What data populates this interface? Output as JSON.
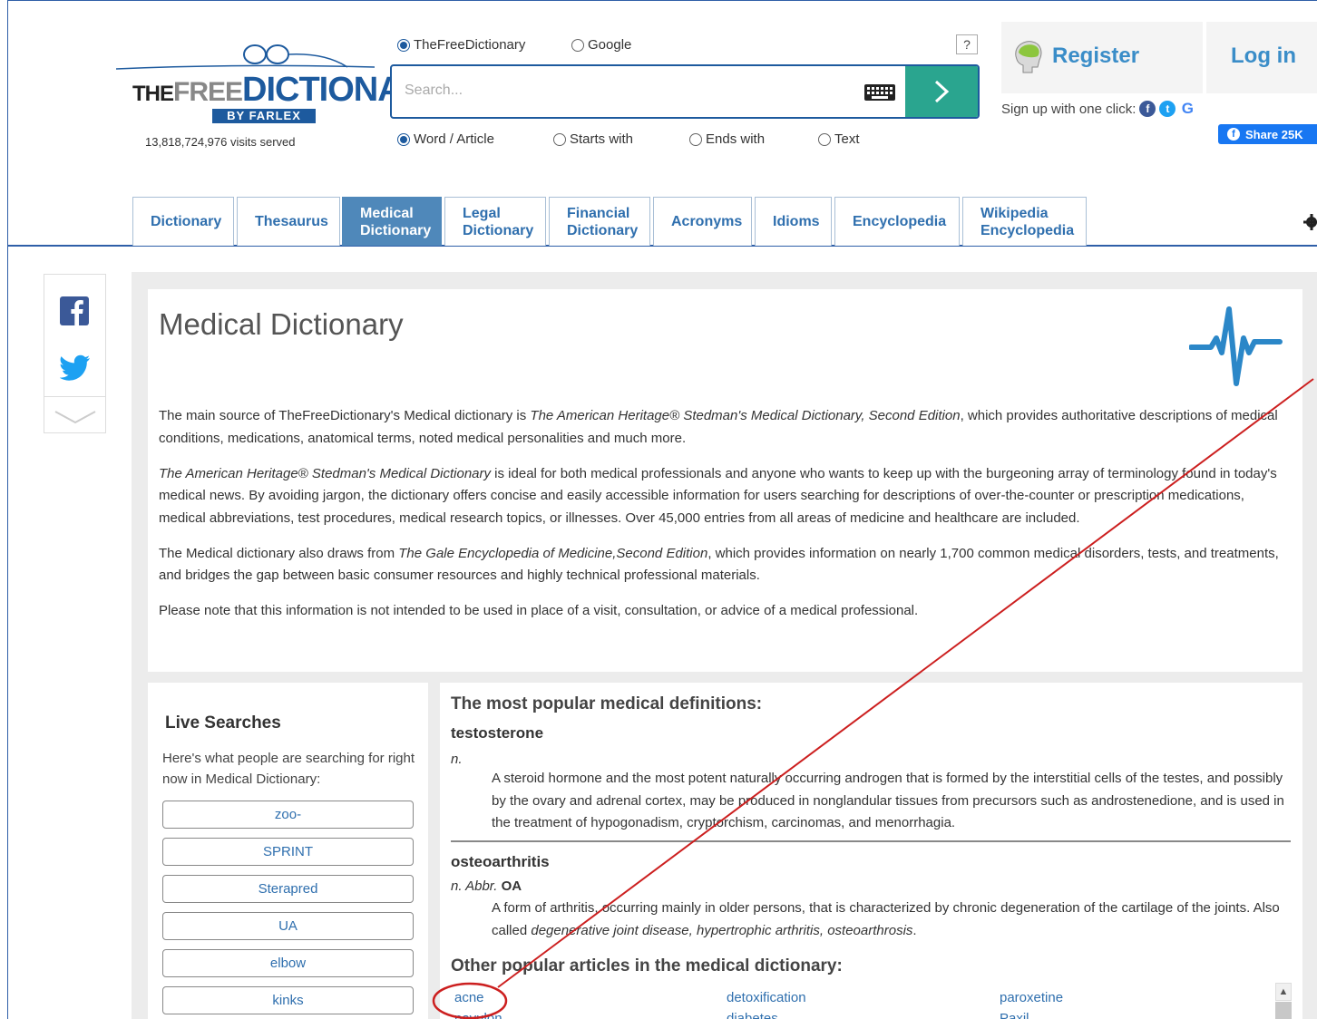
{
  "header": {
    "logo": {
      "the": "THE",
      "free": "FREE",
      "dictionary": "DICTIONARY",
      "byline": "BY FARLEX"
    },
    "visits": "13,818,724,976 visits served",
    "source_options": [
      {
        "label": "TheFreeDictionary",
        "selected": true
      },
      {
        "label": "Google",
        "selected": false
      }
    ],
    "help_label": "?",
    "search": {
      "placeholder": "Search...",
      "value": ""
    },
    "mode_options": [
      {
        "label": "Word / Article",
        "selected": true
      },
      {
        "label": "Starts with",
        "selected": false
      },
      {
        "label": "Ends with",
        "selected": false
      },
      {
        "label": "Text",
        "selected": false
      }
    ],
    "register_label": "Register",
    "login_label": "Log in",
    "signup_text": "Sign up with one click:",
    "share_label": "Share 25K"
  },
  "tabs": [
    {
      "label": "Dictionary",
      "active": false
    },
    {
      "label": "Thesaurus",
      "active": false
    },
    {
      "label": "Medical Dictionary",
      "active": true
    },
    {
      "label": "Legal Dictionary",
      "active": false
    },
    {
      "label": "Financial Dictionary",
      "active": false
    },
    {
      "label": "Acronyms",
      "active": false
    },
    {
      "label": "Idioms",
      "active": false
    },
    {
      "label": "Encyclopedia",
      "active": false
    },
    {
      "label": "Wikipedia Encyclopedia",
      "active": false
    }
  ],
  "intro": {
    "title": "Medical Dictionary",
    "p1_a": "The main source of TheFreeDictionary's Medical dictionary is ",
    "p1_i": "The American Heritage® Stedman's Medical Dictionary, Second Edition",
    "p1_b": ", which provides authoritative descriptions of medical conditions, medications, anatomical terms, noted medical personalities and much more.",
    "p2_i": "The American Heritage® Stedman's Medical Dictionary",
    "p2_b": " is ideal for both medical professionals and anyone who wants to keep up with the burgeoning array of terminology found in today's medical news. By avoiding jargon, the dictionary offers concise and easily accessible information for users searching for descriptions of over-the-counter or prescription medications, medical abbreviations, test procedures, medical research topics, or illnesses. Over 45,000 entries from all areas of medicine and healthcare are included.",
    "p3_a": "The Medical dictionary also draws from ",
    "p3_i": "The Gale Encyclopedia of Medicine,Second Edition",
    "p3_b": ", which provides information on nearly 1,700 common medical disorders, tests, and treatments, and bridges the gap between basic consumer resources and highly technical professional materials.",
    "p4": "Please note that this information is not intended to be used in place of a visit, consultation, or advice of a medical professional."
  },
  "live": {
    "title": "Live Searches",
    "desc": "Here's what people are searching for right now in Medical Dictionary:",
    "items": [
      "zoo-",
      "SPRINT",
      "Sterapred",
      "UA",
      "elbow",
      "kinks"
    ]
  },
  "popular": {
    "heading": "The most popular medical definitions:",
    "entries": [
      {
        "term": "testosterone",
        "pos": "n.",
        "definition": "A steroid hormone and the most potent naturally occurring androgen that is formed by the interstitial cells of the testes, and possibly by the ovary and adrenal cortex, may be produced in nonglandular tissues from precursors such as androstenedione, and is used in the treatment of hypogonadism, cryptorchism, carcinomas, and menorrhagia."
      },
      {
        "term": "osteoarthritis",
        "pos": "n. Abbr.",
        "abbr": "OA",
        "definition": "A form of arthritis, occurring mainly in older persons, that is characterized by chronic degeneration of the cartilage of the joints. Also called ",
        "also_called": "degenerative joint disease, hypertrophic arthritis, osteoarthrosis",
        "end": "."
      }
    ],
    "other_heading": "Other popular articles in the medical dictionary:",
    "articles": [
      [
        "acne",
        "detoxification",
        "paroxetine"
      ],
      [
        "pavulon",
        "diabetes",
        "Paxil"
      ]
    ]
  },
  "colors": {
    "brand_blue": "#1d5a9e",
    "link_blue": "#2f6fae",
    "go_green": "#2aa58f",
    "annotation_red": "#cc1f1f"
  }
}
